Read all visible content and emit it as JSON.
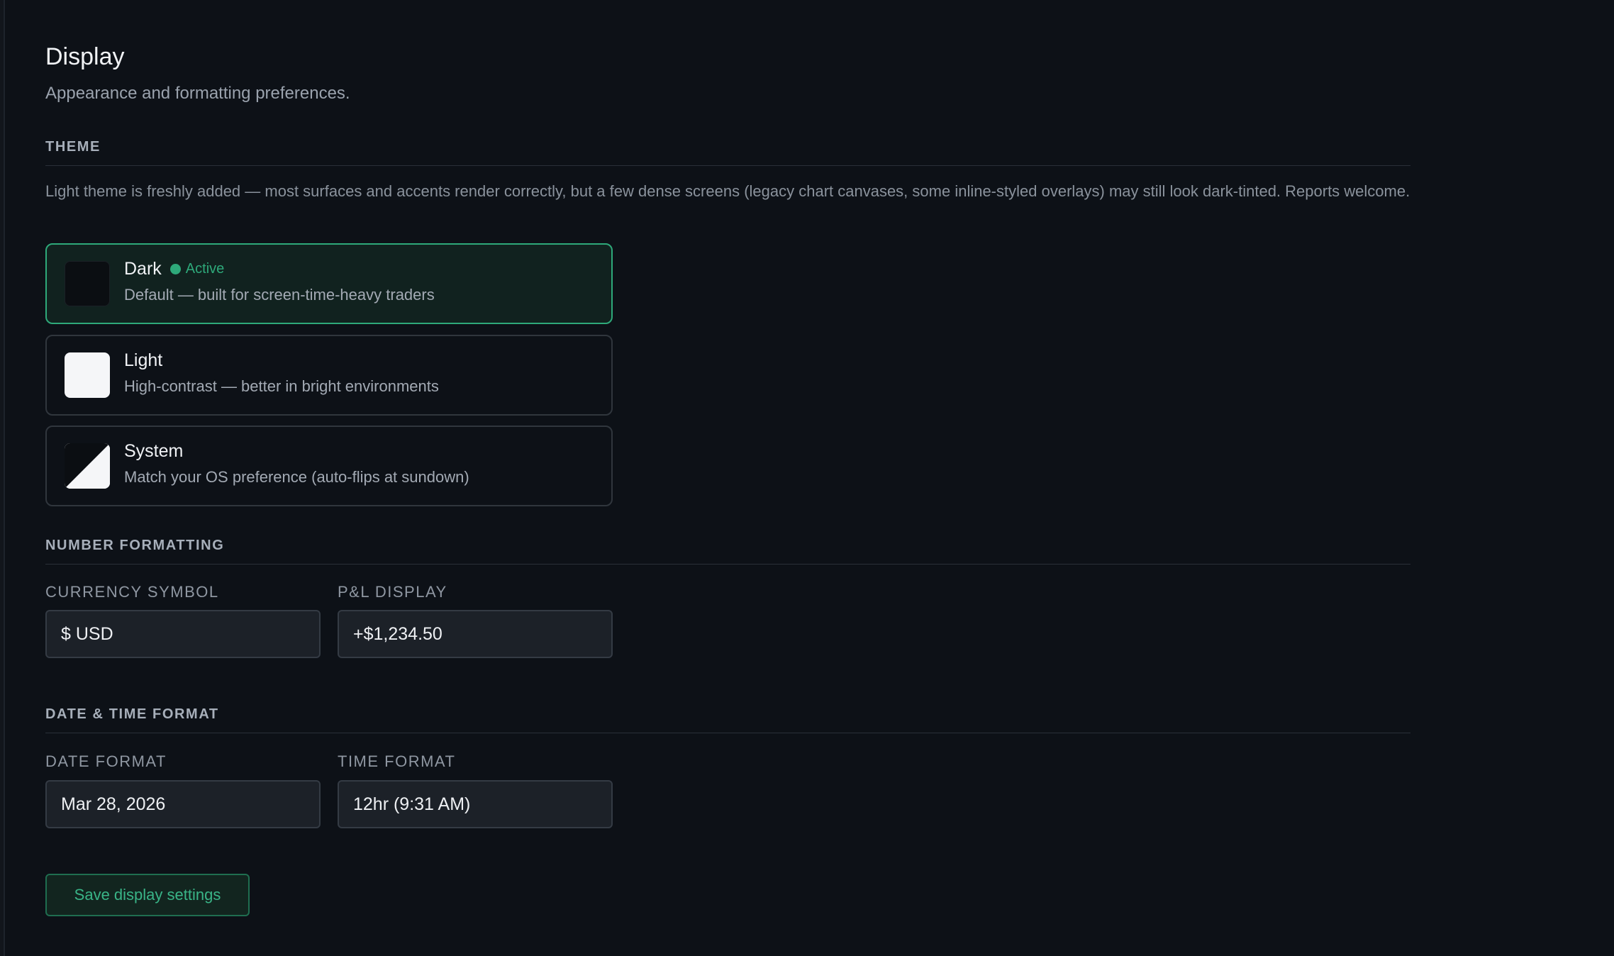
{
  "page": {
    "title": "Display",
    "subtitle": "Appearance and formatting preferences."
  },
  "theme": {
    "heading": "THEME",
    "note": "Light theme is freshly added — most surfaces and accents render correctly, but a few dense screens (legacy chart canvases, some inline-styled overlays) may still look dark-tinted. Reports welcome.",
    "options": [
      {
        "title": "Dark",
        "description": "Default — built for screen-time-heavy traders",
        "active": true,
        "active_label": "Active"
      },
      {
        "title": "Light",
        "description": "High-contrast — better in bright environments",
        "active": false
      },
      {
        "title": "System",
        "description": "Match your OS preference (auto-flips at sundown)",
        "active": false
      }
    ]
  },
  "number_formatting": {
    "heading": "NUMBER FORMATTING",
    "currency_label": "CURRENCY SYMBOL",
    "currency_value": "$ USD",
    "pnl_label": "P&L DISPLAY",
    "pnl_value": "+$1,234.50"
  },
  "date_time": {
    "heading": "DATE & TIME FORMAT",
    "date_label": "DATE FORMAT",
    "date_value": "Mar 28, 2026",
    "time_label": "TIME FORMAT",
    "time_value": "12hr (9:31 AM)"
  },
  "actions": {
    "save_label": "Save display settings"
  },
  "colors": {
    "background": "#0d1117",
    "accent": "#2ea97a",
    "active_card_bg": "#11221f",
    "input_bg": "#1c2128"
  }
}
